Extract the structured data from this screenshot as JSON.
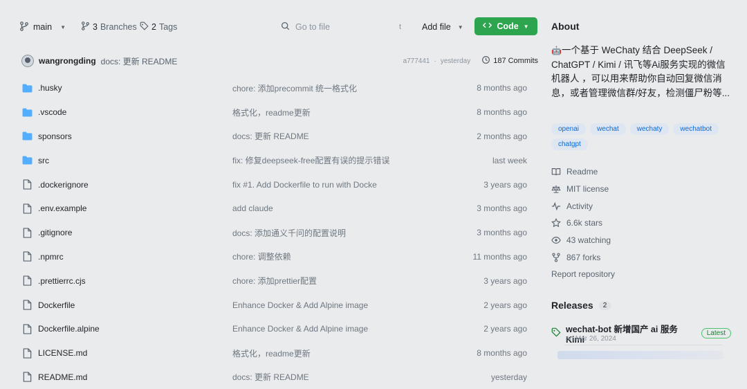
{
  "toolbar": {
    "branch": "main",
    "branches_count": "3",
    "branches_label": "Branches",
    "tags_count": "2",
    "tags_label": "Tags",
    "search_placeholder": "Go to file",
    "search_shortcut": "t",
    "add_file_label": "Add file",
    "code_label": "Code"
  },
  "commit": {
    "author": "wangrongding",
    "message": "docs: 更新 README",
    "hash": "a777441",
    "separator": "·",
    "time": "yesterday",
    "count_label": "187 Commits"
  },
  "files": [
    {
      "type": "folder",
      "name": ".husky",
      "message": "chore: 添加precommit 统一格式化",
      "date": "8 months ago"
    },
    {
      "type": "folder",
      "name": ".vscode",
      "message": "格式化，readme更新",
      "date": "8 months ago"
    },
    {
      "type": "folder",
      "name": "sponsors",
      "message": "docs: 更新 README",
      "date": "2 months ago"
    },
    {
      "type": "folder",
      "name": "src",
      "message": "fix: 修复deepseek-free配置有误的提示错误",
      "date": "last week"
    },
    {
      "type": "file",
      "name": ".dockerignore",
      "message": "fix #1. Add Dockerfile to run with Docke",
      "date": "3 years ago"
    },
    {
      "type": "file",
      "name": ".env.example",
      "message": "add claude",
      "date": "3 months ago"
    },
    {
      "type": "file",
      "name": ".gitignore",
      "message": "docs: 添加通义千问的配置说明",
      "date": "3 months ago"
    },
    {
      "type": "file",
      "name": ".npmrc",
      "message": "chore: 调整依赖",
      "date": "11 months ago"
    },
    {
      "type": "file",
      "name": ".prettierrc.cjs",
      "message": "chore: 添加prettier配置",
      "date": "3 years ago"
    },
    {
      "type": "file",
      "name": "Dockerfile",
      "message": "Enhance Docker & Add Alpine image",
      "date": "2 years ago"
    },
    {
      "type": "file",
      "name": "Dockerfile.alpine",
      "message": "Enhance Docker & Add Alpine image",
      "date": "2 years ago"
    },
    {
      "type": "file",
      "name": "LICENSE.md",
      "message": "格式化，readme更新",
      "date": "8 months ago"
    },
    {
      "type": "file",
      "name": "README.md",
      "message": "docs: 更新 README",
      "date": "yesterday"
    }
  ],
  "about": {
    "heading": "About",
    "description": "一个基于 WeChaty 结合 DeepSeek / ChatGPT / Kimi / 讯飞等Ai服务实现的微信机器人 ，可以用来帮助你自动回复微信消息，或者管理微信群/好友，检测僵尸粉等...",
    "topics": [
      "openai",
      "wechat",
      "wechaty",
      "wechatbot",
      "chatgpt"
    ],
    "readme": "Readme",
    "license": "MIT license",
    "activity": "Activity",
    "stars": "6.6k stars",
    "watching": "43 watching",
    "forks": "867 forks",
    "report": "Report repository"
  },
  "releases": {
    "heading": "Releases",
    "count": "2",
    "latest_name": "wechat-bot 新增国产 ai 服务 Kimi",
    "latest_badge": "Latest",
    "latest_date": "on Mar 26, 2024"
  },
  "colors": {
    "accent": "#2da44e",
    "link": "#0969da",
    "folder": "#54aeff"
  }
}
